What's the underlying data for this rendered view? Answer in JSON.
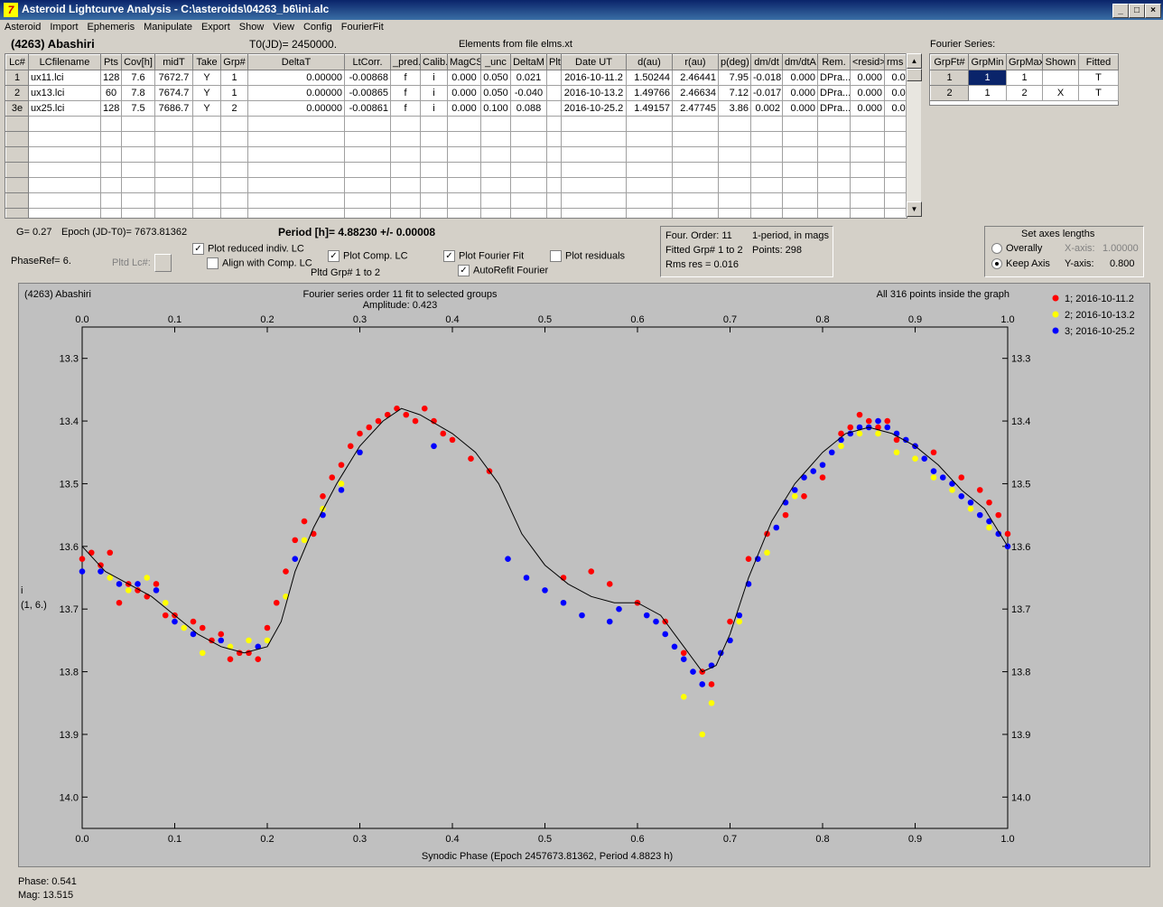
{
  "window": {
    "title": "Asteroid Lightcurve Analysis - C:\\asteroids\\04263_b6\\ini.alc",
    "app_icon_glyph": "7",
    "buttons": {
      "minimize": "_",
      "maximize": "□",
      "close": "×"
    }
  },
  "menu": [
    "Asteroid",
    "Import",
    "Ephemeris",
    "Manipulate",
    "Export",
    "Show",
    "View",
    "Config",
    "FourierFit"
  ],
  "header": {
    "asteroid": "(4263) Abashiri",
    "t0": "T0(JD)= 2450000.",
    "elements": "Elements from file elms.xt"
  },
  "lc_table": {
    "headers": [
      "Lc#",
      "LCfilename",
      "Pts",
      "Cov[h]",
      "midT",
      "Take",
      "Grp#",
      "DeltaT",
      "LtCorr.",
      "_pred.",
      "Calib.",
      "MagCS",
      "_unc",
      "DeltaM",
      "Plt",
      "Date UT",
      "d(au)",
      "r(au)",
      "p(deg)",
      "dm/dt",
      "dm/dtA",
      "Rem.",
      "<resid>",
      "rms res"
    ],
    "rows": [
      [
        "1",
        "ux11.lci",
        "128",
        "7.6",
        "7672.7",
        "Y",
        "1",
        "0.00000",
        "-0.00868",
        "f",
        "i",
        "0.000",
        "0.050",
        "0.021",
        "",
        "2016-10-11.2",
        "1.50244",
        "2.46441",
        "7.95",
        "-0.018",
        "0.000",
        "DPra...",
        "0.000",
        "0.015"
      ],
      [
        "2",
        "ux13.lci",
        "60",
        "7.8",
        "7674.7",
        "Y",
        "1",
        "0.00000",
        "-0.00865",
        "f",
        "i",
        "0.000",
        "0.050",
        "-0.040",
        "",
        "2016-10-13.2",
        "1.49766",
        "2.46634",
        "7.12",
        "-0.017",
        "0.000",
        "DPra...",
        "0.000",
        "0.016"
      ],
      [
        "3e",
        "ux25.lci",
        "128",
        "7.5",
        "7686.7",
        "Y",
        "2",
        "0.00000",
        "-0.00861",
        "f",
        "i",
        "0.000",
        "0.100",
        "0.088",
        "",
        "2016-10-25.2",
        "1.49157",
        "2.47745",
        "3.86",
        "0.002",
        "0.000",
        "DPra...",
        "0.000",
        "0.016"
      ]
    ]
  },
  "fourier_series": {
    "title": "Fourier Series:",
    "headers": [
      "GrpFt#",
      "GrpMin",
      "GrpMax",
      "Shown",
      "Fitted"
    ],
    "rows": [
      [
        "1",
        "1",
        "1",
        "",
        "T"
      ],
      [
        "2",
        "1",
        "2",
        "X",
        "T"
      ]
    ]
  },
  "controls": {
    "g": "G= 0.27",
    "epoch": "Epoch (JD-T0)= 7673.81362",
    "period": "Period [h]= 4.88230 +/- 0.00008",
    "phaseref": "PhaseRef= 6.",
    "pltd_lc": "Pltd Lc#:",
    "plot_reduced": "Plot reduced indiv. LC",
    "align_comp": "Align with Comp. LC",
    "plot_comp": "Plot Comp. LC",
    "pltd_grp": "Pltd Grp#  1   to   2",
    "plot_fourier": "Plot Fourier Fit",
    "autorefit": "AutoRefit Fourier",
    "plot_residuals": "Plot residuals",
    "check_mark": "✓"
  },
  "info_box": {
    "order": "Four. Order: 11",
    "mode": "1-period, in mags",
    "fitted": "Fitted Grp# 1 to 2",
    "points": "Points: 298",
    "rms": "Rms res     = 0.016"
  },
  "axes_box": {
    "title": "Set axes lengths",
    "overally": "Overally",
    "keep_axis": "Keep Axis",
    "x_axis_label": "X-axis:",
    "x_axis_value": "1.00000",
    "y_axis_label": "Y-axis:",
    "y_axis_value": "0.800"
  },
  "chart_texts": {
    "top_left": "(4263) Abashiri",
    "top_center": "Fourier series order 11 fit to selected groups",
    "amplitude": "Amplitude: 0.423",
    "top_right": "All 316 points inside the graph",
    "ylabel_1": "i",
    "ylabel_2": "(1, 6.)"
  },
  "status": {
    "phase": "Phase:  0.541",
    "mag": "Mag:    13.515"
  },
  "colors": {
    "s1": "#ff0000",
    "s2": "#ffff00",
    "s3": "#0000ff",
    "plot_bg": "#c0c0c0"
  },
  "chart_data": {
    "type": "scatter",
    "xlabel": "Synodic Phase (Epoch 2457673.81362, Period 4.8823 h)",
    "ylabel": "",
    "xlim": [
      0,
      1
    ],
    "ylim": [
      14.05,
      13.25
    ],
    "y_inverted": true,
    "x_ticks": [
      0.0,
      0.1,
      0.2,
      0.3,
      0.4,
      0.5,
      0.6,
      0.7,
      0.8,
      0.9,
      1.0
    ],
    "y_ticks": [
      13.3,
      13.4,
      13.5,
      13.6,
      13.7,
      13.8,
      13.9,
      14.0
    ],
    "legend_position": "right",
    "series": [
      {
        "name": "1; 2016-10-11.2",
        "color": "#ff0000",
        "points": [
          [
            0.0,
            13.62
          ],
          [
            0.01,
            13.61
          ],
          [
            0.02,
            13.63
          ],
          [
            0.03,
            13.61
          ],
          [
            0.04,
            13.69
          ],
          [
            0.05,
            13.66
          ],
          [
            0.06,
            13.67
          ],
          [
            0.07,
            13.68
          ],
          [
            0.08,
            13.66
          ],
          [
            0.09,
            13.71
          ],
          [
            0.1,
            13.71
          ],
          [
            0.12,
            13.72
          ],
          [
            0.13,
            13.73
          ],
          [
            0.14,
            13.75
          ],
          [
            0.15,
            13.74
          ],
          [
            0.16,
            13.78
          ],
          [
            0.17,
            13.77
          ],
          [
            0.18,
            13.77
          ],
          [
            0.19,
            13.78
          ],
          [
            0.2,
            13.73
          ],
          [
            0.21,
            13.69
          ],
          [
            0.22,
            13.64
          ],
          [
            0.23,
            13.59
          ],
          [
            0.24,
            13.56
          ],
          [
            0.25,
            13.58
          ],
          [
            0.26,
            13.52
          ],
          [
            0.27,
            13.49
          ],
          [
            0.28,
            13.47
          ],
          [
            0.29,
            13.44
          ],
          [
            0.3,
            13.42
          ],
          [
            0.31,
            13.41
          ],
          [
            0.32,
            13.4
          ],
          [
            0.33,
            13.39
          ],
          [
            0.34,
            13.38
          ],
          [
            0.35,
            13.39
          ],
          [
            0.36,
            13.4
          ],
          [
            0.37,
            13.38
          ],
          [
            0.38,
            13.4
          ],
          [
            0.39,
            13.42
          ],
          [
            0.4,
            13.43
          ],
          [
            0.42,
            13.46
          ],
          [
            0.44,
            13.48
          ],
          [
            0.52,
            13.65
          ],
          [
            0.55,
            13.64
          ],
          [
            0.57,
            13.66
          ],
          [
            0.6,
            13.69
          ],
          [
            0.63,
            13.72
          ],
          [
            0.65,
            13.77
          ],
          [
            0.67,
            13.8
          ],
          [
            0.68,
            13.82
          ],
          [
            0.7,
            13.72
          ],
          [
            0.72,
            13.62
          ],
          [
            0.74,
            13.58
          ],
          [
            0.76,
            13.55
          ],
          [
            0.78,
            13.52
          ],
          [
            0.8,
            13.49
          ],
          [
            0.82,
            13.42
          ],
          [
            0.83,
            13.41
          ],
          [
            0.84,
            13.39
          ],
          [
            0.85,
            13.4
          ],
          [
            0.86,
            13.41
          ],
          [
            0.87,
            13.4
          ],
          [
            0.88,
            13.43
          ],
          [
            0.9,
            13.44
          ],
          [
            0.92,
            13.45
          ],
          [
            0.95,
            13.49
          ],
          [
            0.97,
            13.51
          ],
          [
            0.98,
            13.53
          ],
          [
            0.99,
            13.55
          ],
          [
            1.0,
            13.58
          ]
        ]
      },
      {
        "name": "2; 2016-10-13.2",
        "color": "#ffff00",
        "points": [
          [
            0.03,
            13.65
          ],
          [
            0.05,
            13.67
          ],
          [
            0.07,
            13.65
          ],
          [
            0.09,
            13.69
          ],
          [
            0.11,
            13.73
          ],
          [
            0.13,
            13.77
          ],
          [
            0.16,
            13.76
          ],
          [
            0.18,
            13.75
          ],
          [
            0.2,
            13.75
          ],
          [
            0.22,
            13.68
          ],
          [
            0.24,
            13.59
          ],
          [
            0.26,
            13.54
          ],
          [
            0.28,
            13.5
          ],
          [
            0.3,
            13.45
          ],
          [
            0.65,
            13.84
          ],
          [
            0.67,
            13.9
          ],
          [
            0.68,
            13.85
          ],
          [
            0.71,
            13.72
          ],
          [
            0.74,
            13.61
          ],
          [
            0.77,
            13.52
          ],
          [
            0.8,
            13.47
          ],
          [
            0.82,
            13.44
          ],
          [
            0.84,
            13.42
          ],
          [
            0.86,
            13.42
          ],
          [
            0.88,
            13.45
          ],
          [
            0.9,
            13.46
          ],
          [
            0.92,
            13.49
          ],
          [
            0.94,
            13.51
          ],
          [
            0.96,
            13.54
          ],
          [
            0.98,
            13.57
          ]
        ]
      },
      {
        "name": "3; 2016-10-25.2",
        "color": "#0000ff",
        "points": [
          [
            0.0,
            13.64
          ],
          [
            0.02,
            13.64
          ],
          [
            0.04,
            13.66
          ],
          [
            0.06,
            13.66
          ],
          [
            0.08,
            13.67
          ],
          [
            0.1,
            13.72
          ],
          [
            0.12,
            13.74
          ],
          [
            0.15,
            13.75
          ],
          [
            0.19,
            13.76
          ],
          [
            0.23,
            13.62
          ],
          [
            0.26,
            13.55
          ],
          [
            0.28,
            13.51
          ],
          [
            0.3,
            13.45
          ],
          [
            0.38,
            13.44
          ],
          [
            0.46,
            13.62
          ],
          [
            0.48,
            13.65
          ],
          [
            0.5,
            13.67
          ],
          [
            0.52,
            13.69
          ],
          [
            0.54,
            13.71
          ],
          [
            0.57,
            13.72
          ],
          [
            0.58,
            13.7
          ],
          [
            0.61,
            13.71
          ],
          [
            0.62,
            13.72
          ],
          [
            0.63,
            13.74
          ],
          [
            0.64,
            13.76
          ],
          [
            0.65,
            13.78
          ],
          [
            0.66,
            13.8
          ],
          [
            0.67,
            13.82
          ],
          [
            0.68,
            13.79
          ],
          [
            0.69,
            13.77
          ],
          [
            0.7,
            13.75
          ],
          [
            0.71,
            13.71
          ],
          [
            0.72,
            13.66
          ],
          [
            0.73,
            13.62
          ],
          [
            0.75,
            13.57
          ],
          [
            0.76,
            13.53
          ],
          [
            0.77,
            13.51
          ],
          [
            0.78,
            13.49
          ],
          [
            0.79,
            13.48
          ],
          [
            0.8,
            13.47
          ],
          [
            0.81,
            13.45
          ],
          [
            0.82,
            13.43
          ],
          [
            0.83,
            13.42
          ],
          [
            0.84,
            13.41
          ],
          [
            0.85,
            13.41
          ],
          [
            0.86,
            13.4
          ],
          [
            0.87,
            13.41
          ],
          [
            0.88,
            13.42
          ],
          [
            0.89,
            13.43
          ],
          [
            0.9,
            13.44
          ],
          [
            0.91,
            13.46
          ],
          [
            0.92,
            13.48
          ],
          [
            0.93,
            13.49
          ],
          [
            0.94,
            13.5
          ],
          [
            0.95,
            13.52
          ],
          [
            0.96,
            13.53
          ],
          [
            0.97,
            13.55
          ],
          [
            0.98,
            13.56
          ],
          [
            0.99,
            13.58
          ],
          [
            1.0,
            13.6
          ]
        ]
      }
    ],
    "fit_curve": [
      [
        0.0,
        13.6
      ],
      [
        0.025,
        13.64
      ],
      [
        0.05,
        13.66
      ],
      [
        0.075,
        13.68
      ],
      [
        0.1,
        13.71
      ],
      [
        0.125,
        13.74
      ],
      [
        0.15,
        13.76
      ],
      [
        0.175,
        13.77
      ],
      [
        0.2,
        13.76
      ],
      [
        0.215,
        13.72
      ],
      [
        0.23,
        13.64
      ],
      [
        0.25,
        13.57
      ],
      [
        0.275,
        13.5
      ],
      [
        0.3,
        13.44
      ],
      [
        0.325,
        13.4
      ],
      [
        0.345,
        13.38
      ],
      [
        0.365,
        13.39
      ],
      [
        0.4,
        13.42
      ],
      [
        0.425,
        13.45
      ],
      [
        0.45,
        13.5
      ],
      [
        0.475,
        13.58
      ],
      [
        0.5,
        13.63
      ],
      [
        0.525,
        13.66
      ],
      [
        0.55,
        13.68
      ],
      [
        0.575,
        13.69
      ],
      [
        0.6,
        13.69
      ],
      [
        0.625,
        13.71
      ],
      [
        0.65,
        13.76
      ],
      [
        0.67,
        13.8
      ],
      [
        0.685,
        13.79
      ],
      [
        0.7,
        13.74
      ],
      [
        0.72,
        13.65
      ],
      [
        0.745,
        13.56
      ],
      [
        0.77,
        13.5
      ],
      [
        0.8,
        13.45
      ],
      [
        0.825,
        13.42
      ],
      [
        0.85,
        13.41
      ],
      [
        0.875,
        13.42
      ],
      [
        0.9,
        13.44
      ],
      [
        0.925,
        13.47
      ],
      [
        0.95,
        13.51
      ],
      [
        0.975,
        13.54
      ],
      [
        1.0,
        13.6
      ]
    ]
  }
}
